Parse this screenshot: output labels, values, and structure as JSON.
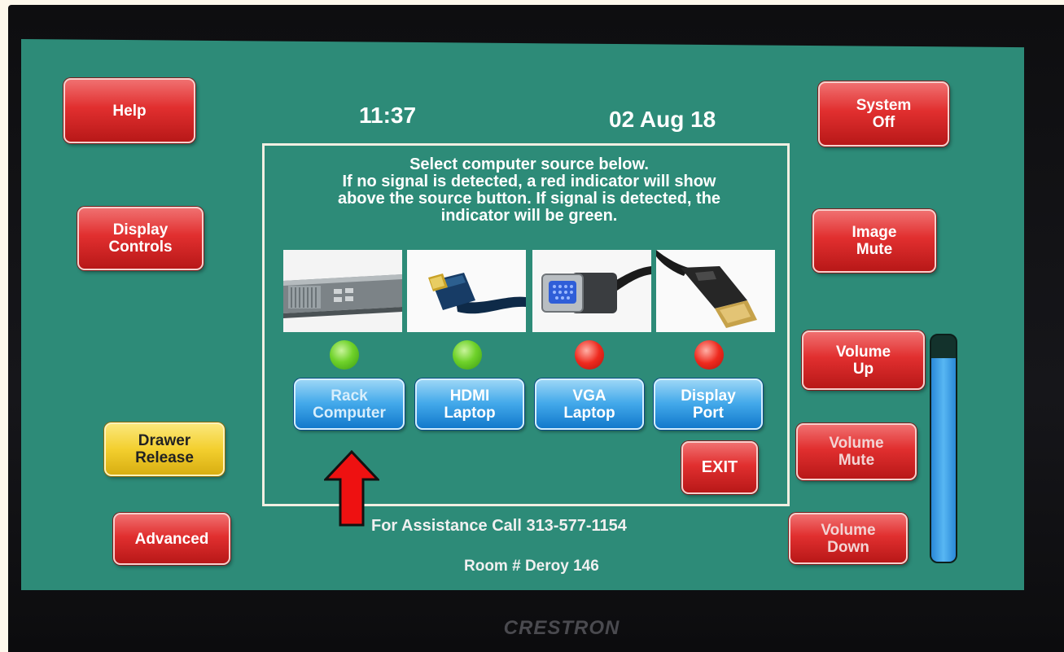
{
  "header": {
    "time": "11:37",
    "date": "02 Aug 18"
  },
  "left_buttons": {
    "help": "Help",
    "display_controls": "Display\nControls",
    "drawer_release": "Drawer\nRelease",
    "advanced": "Advanced"
  },
  "right_buttons": {
    "system_off": "System\nOff",
    "image_mute": "Image\nMute",
    "volume_up": "Volume\nUp",
    "volume_mute": "Volume\nMute",
    "volume_down": "Volume\nDown"
  },
  "instructions": {
    "line1": "Select computer source below.",
    "line2": "If no signal is detected, a red indicator will show",
    "line3": "above the source button.  If signal is detected, the",
    "line4": "indicator will be green."
  },
  "sources": [
    {
      "label": "Rack\nComputer",
      "signal": "green",
      "image": "rack-server-icon"
    },
    {
      "label": "HDMI\nLaptop",
      "signal": "green",
      "image": "hdmi-cable-icon"
    },
    {
      "label": "VGA\nLaptop",
      "signal": "red",
      "image": "vga-cable-icon"
    },
    {
      "label": "Display\nPort",
      "signal": "red",
      "image": "displayport-cable-icon"
    }
  ],
  "exit_label": "EXIT",
  "footer": {
    "assistance": "For Assistance Call 313-577-1154",
    "room": "Room # Deroy 146"
  },
  "volume_level_fraction": 0.9,
  "brand": "CRESTRON",
  "colors": {
    "screen": "#2d8b78",
    "green_indicator": "#6fd22a",
    "red_indicator": "#ee2a1e"
  }
}
